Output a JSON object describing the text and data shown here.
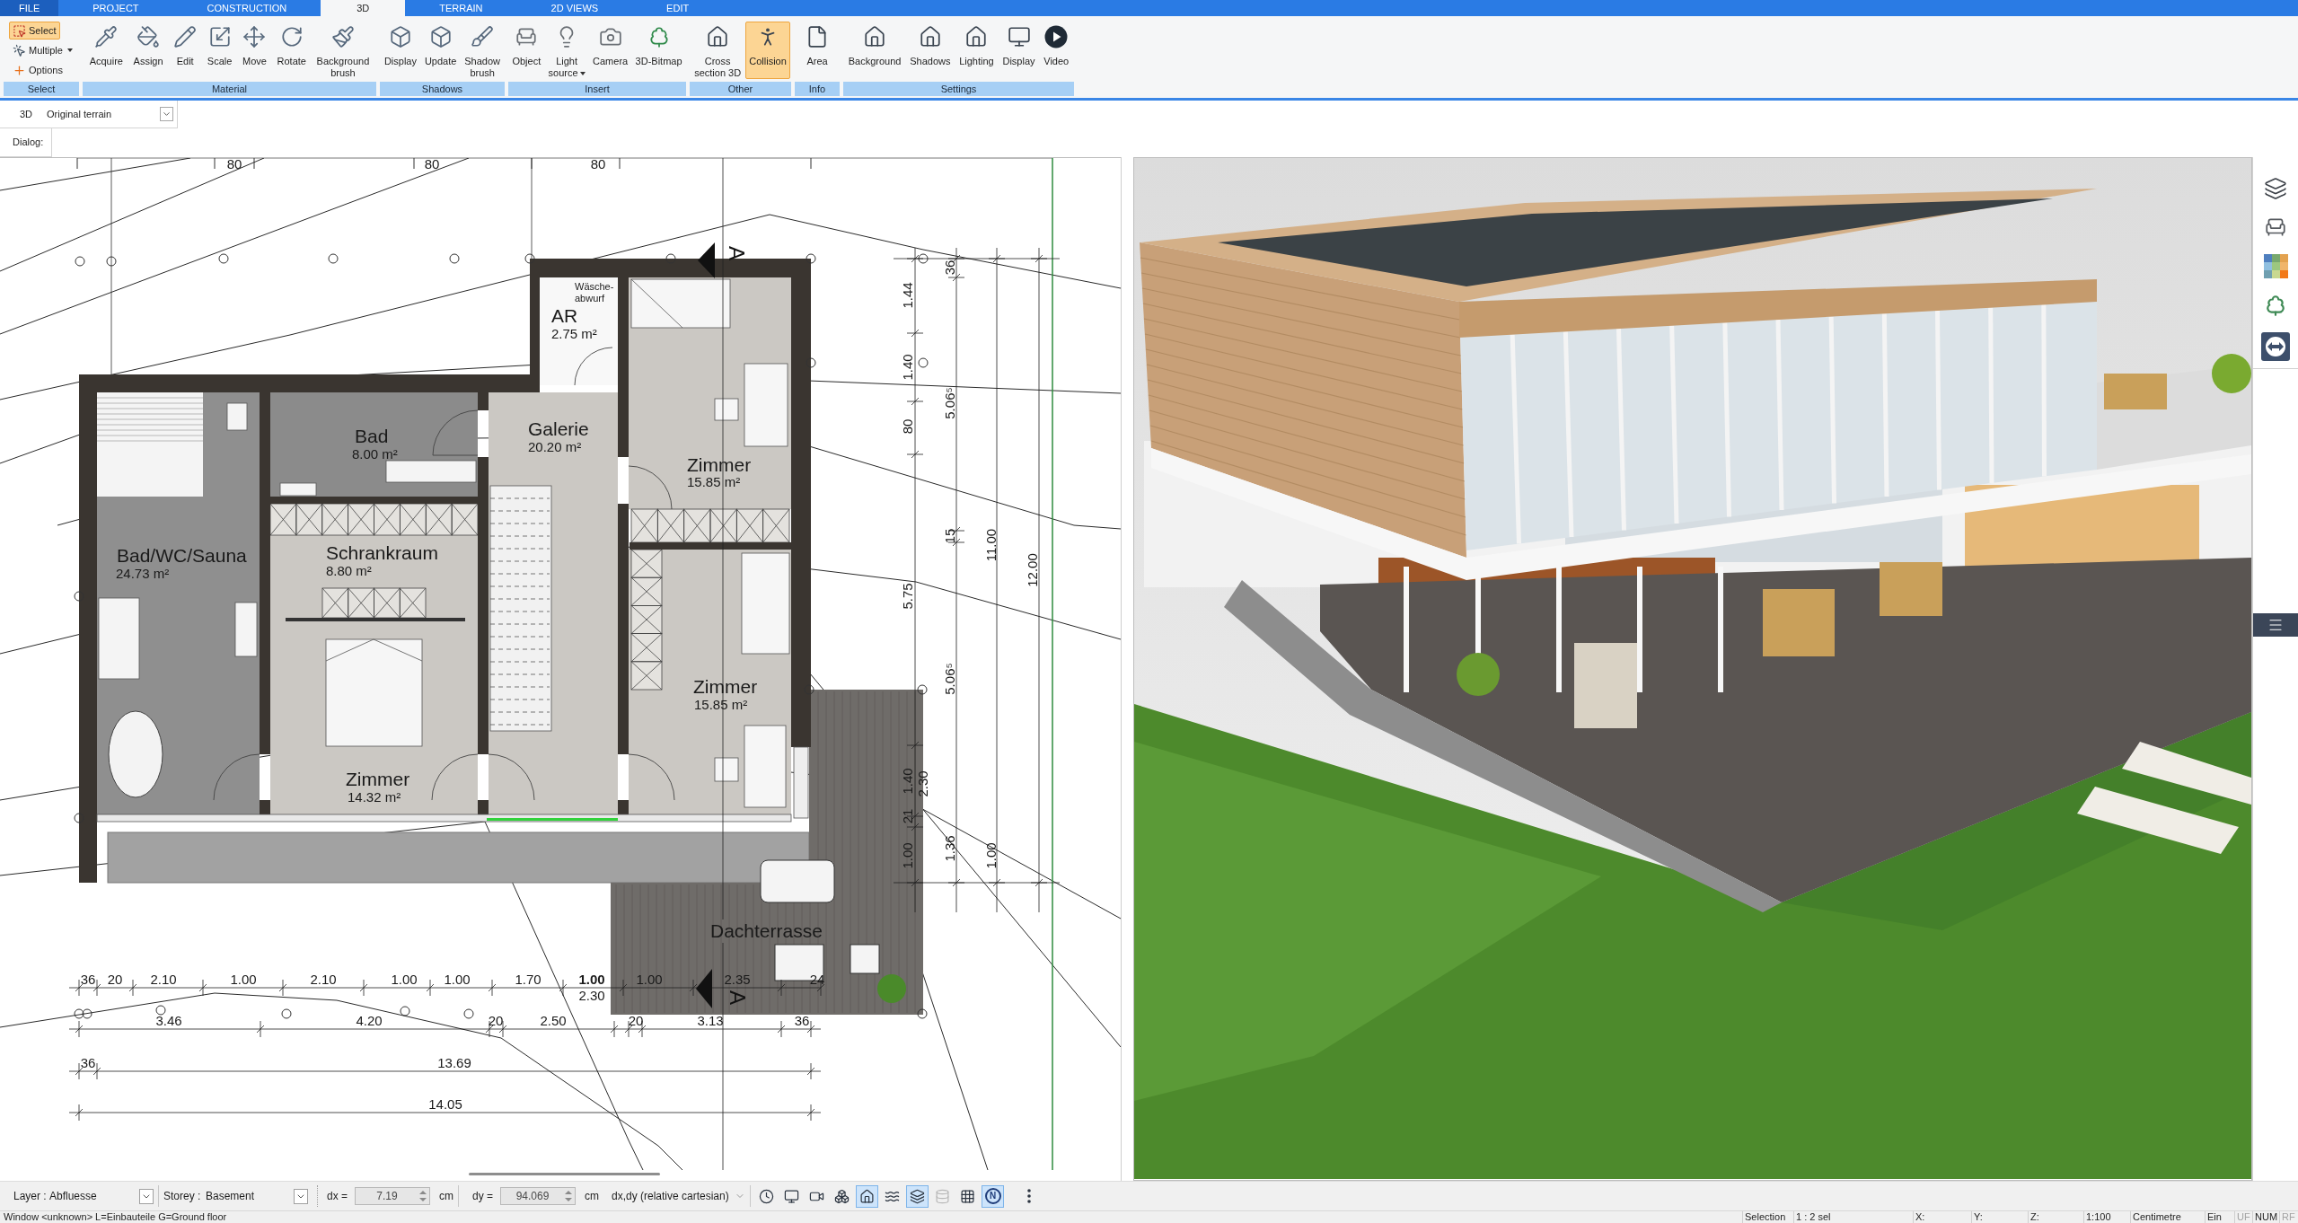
{
  "ribbon_tabs": [
    {
      "label": "FILE",
      "kind": "menu",
      "selected": false
    },
    {
      "label": "PROJECT",
      "kind": "tab",
      "selected": false
    },
    {
      "label": "CONSTRUCTION",
      "kind": "tab",
      "selected": false
    },
    {
      "label": "3D",
      "kind": "tab",
      "selected": true
    },
    {
      "label": "TERRAIN",
      "kind": "tab",
      "selected": false
    },
    {
      "label": "2D VIEWS",
      "kind": "tab",
      "selected": false
    },
    {
      "label": "EDIT",
      "kind": "tab",
      "selected": false
    }
  ],
  "ribbon_groups": [
    {
      "label": "Select",
      "buttons": [
        {
          "label": "Select",
          "kind": "small",
          "selected": true,
          "dropdown": false
        },
        {
          "label": "Multiple",
          "kind": "small",
          "selected": false,
          "dropdown": true
        },
        {
          "label": "Options",
          "kind": "small",
          "selected": false,
          "dropdown": false
        }
      ]
    },
    {
      "label": "Material",
      "buttons": [
        {
          "label": "Acquire",
          "kind": "large",
          "selected": false,
          "dropdown": false
        },
        {
          "label": "Assign",
          "kind": "large",
          "selected": false,
          "dropdown": false
        },
        {
          "label": "Edit",
          "kind": "large",
          "selected": false,
          "dropdown": false
        },
        {
          "label": "Scale",
          "kind": "large",
          "selected": false,
          "dropdown": false
        },
        {
          "label": "Move",
          "kind": "large",
          "selected": false,
          "dropdown": false
        },
        {
          "label": "Rotate",
          "kind": "large",
          "selected": false,
          "dropdown": false
        },
        {
          "label": "Background brush",
          "kind": "large",
          "selected": false,
          "dropdown": false
        }
      ]
    },
    {
      "label": "Shadows",
      "buttons": [
        {
          "label": "Display",
          "kind": "large",
          "selected": false,
          "dropdown": false
        },
        {
          "label": "Update",
          "kind": "large",
          "selected": false,
          "dropdown": false
        },
        {
          "label": "Shadow brush",
          "kind": "large",
          "selected": false,
          "dropdown": false
        }
      ]
    },
    {
      "label": "Insert",
      "buttons": [
        {
          "label": "Object",
          "kind": "large",
          "selected": false,
          "dropdown": false
        },
        {
          "label": "Light source",
          "kind": "large",
          "selected": false,
          "dropdown": true
        },
        {
          "label": "Camera",
          "kind": "large",
          "selected": false,
          "dropdown": false
        },
        {
          "label": "3D-Bitmap",
          "kind": "large",
          "selected": false,
          "dropdown": false
        }
      ]
    },
    {
      "label": "Other",
      "buttons": [
        {
          "label": "Cross section 3D",
          "kind": "large",
          "selected": false,
          "dropdown": false
        },
        {
          "label": "Collision",
          "kind": "large",
          "selected": true,
          "dropdown": false
        }
      ]
    },
    {
      "label": "Info",
      "buttons": [
        {
          "label": "Area",
          "kind": "large",
          "selected": false,
          "dropdown": false
        }
      ]
    },
    {
      "label": "Settings",
      "buttons": [
        {
          "label": "Background",
          "kind": "large",
          "selected": false,
          "dropdown": false
        },
        {
          "label": "Shadows",
          "kind": "large",
          "selected": false,
          "dropdown": false
        },
        {
          "label": "Lighting",
          "kind": "large",
          "selected": false,
          "dropdown": false
        },
        {
          "label": "Display",
          "kind": "large",
          "selected": false,
          "dropdown": false
        },
        {
          "label": "Video",
          "kind": "large",
          "selected": false,
          "dropdown": false
        }
      ]
    }
  ],
  "view_bar": {
    "mode": "3D",
    "terrain": "Original terrain"
  },
  "dialog_label": "Dialog:",
  "floor_plan": {
    "top_dimensions": [
      "80",
      "80",
      "80"
    ],
    "rooms": [
      {
        "name": "AR",
        "area": "2.75 m²"
      },
      {
        "name": "Bad",
        "area": "8.00 m²"
      },
      {
        "name": "Galerie",
        "area": "20.20 m²"
      },
      {
        "name": "Zimmer",
        "area": "15.85 m²"
      },
      {
        "name": "Bad/WC/Sauna",
        "area": "24.73 m²"
      },
      {
        "name": "Schrankraum",
        "area": "8.80 m²"
      },
      {
        "name": "Zimmer",
        "area": "15.85 m²"
      },
      {
        "name": "Zimmer",
        "area": "14.32 m²"
      },
      {
        "name": "Dachterrasse"
      }
    ],
    "note_lines": [
      "Wäsche-",
      "abwurf"
    ],
    "section_marks": [
      "A",
      "A"
    ],
    "vertical_dimensions": [
      "36",
      "1.44",
      "1.40",
      "5.06⁵",
      "80",
      "15",
      "11.00",
      "12.00",
      "5.75",
      "5.06⁵",
      "1.40",
      "2.30",
      "21",
      "1.36",
      "1.00",
      "1.00"
    ],
    "horizontal_dimensions": [
      {
        "text": "36",
        "bold": false
      },
      {
        "text": "20",
        "bold": false
      },
      {
        "text": "2.10",
        "bold": false
      },
      {
        "text": "1.00",
        "bold": false
      },
      {
        "text": "2.10",
        "bold": false
      },
      {
        "text": "1.00",
        "bold": false
      },
      {
        "text": "1.00",
        "bold": false
      },
      {
        "text": "1.70",
        "bold": false
      },
      {
        "text": "1.00",
        "bold": true
      },
      {
        "text": "1.00",
        "bold": false
      },
      {
        "text": "2.35",
        "bold": false
      },
      {
        "text": "24",
        "bold": false
      },
      {
        "text": "2.30",
        "bold": false
      },
      {
        "text": "3.46",
        "bold": false
      },
      {
        "text": "4.20",
        "bold": false
      },
      {
        "text": "20",
        "bold": false
      },
      {
        "text": "2.50",
        "bold": false
      },
      {
        "text": "20",
        "bold": false
      },
      {
        "text": "3.13",
        "bold": false
      },
      {
        "text": "36",
        "bold": false
      },
      {
        "text": "36",
        "bold": false
      },
      {
        "text": "13.69",
        "bold": false
      },
      {
        "text": "14.05",
        "bold": false
      }
    ]
  },
  "bottom_toolbar": {
    "layer": {
      "label": "Layer :",
      "value": "Abfluesse"
    },
    "storey": {
      "label": "Storey :",
      "value": "Basement"
    },
    "dx": {
      "label": "dx =",
      "value": "7.19",
      "unit": "cm",
      "disabled": true
    },
    "dy": {
      "label": "dy =",
      "value": "94.069",
      "unit": "cm",
      "disabled": true
    },
    "coordinate_mode": "dx,dy (relative cartesian)",
    "toggles": [
      {
        "selected": false,
        "disabled": false
      },
      {
        "selected": false,
        "disabled": false
      },
      {
        "selected": false,
        "disabled": false
      },
      {
        "selected": false,
        "disabled": false
      },
      {
        "selected": true,
        "disabled": false
      },
      {
        "selected": false,
        "disabled": false
      },
      {
        "selected": true,
        "disabled": false
      },
      {
        "selected": false,
        "disabled": true
      },
      {
        "selected": false,
        "disabled": false
      },
      {
        "label": "N",
        "selected": true,
        "disabled": false
      },
      {
        "selected": false,
        "disabled": false
      }
    ]
  },
  "status_bar": {
    "message": "Window <unknown> L=Einbauteile G=Ground floor",
    "cells": [
      {
        "text": "Selection",
        "disabled": false
      },
      {
        "text": "1 : 2 sel",
        "disabled": false
      },
      {
        "text": "X:",
        "disabled": false
      },
      {
        "text": "Y:",
        "disabled": false
      },
      {
        "text": "Z:",
        "disabled": false
      },
      {
        "text": "1:100",
        "disabled": false
      },
      {
        "text": "Centimetre",
        "disabled": false
      },
      {
        "text": "Ein",
        "disabled": false
      },
      {
        "text": "UF",
        "disabled": true
      },
      {
        "text": "NUM",
        "disabled": false
      },
      {
        "text": "RF",
        "disabled": true
      }
    ]
  }
}
